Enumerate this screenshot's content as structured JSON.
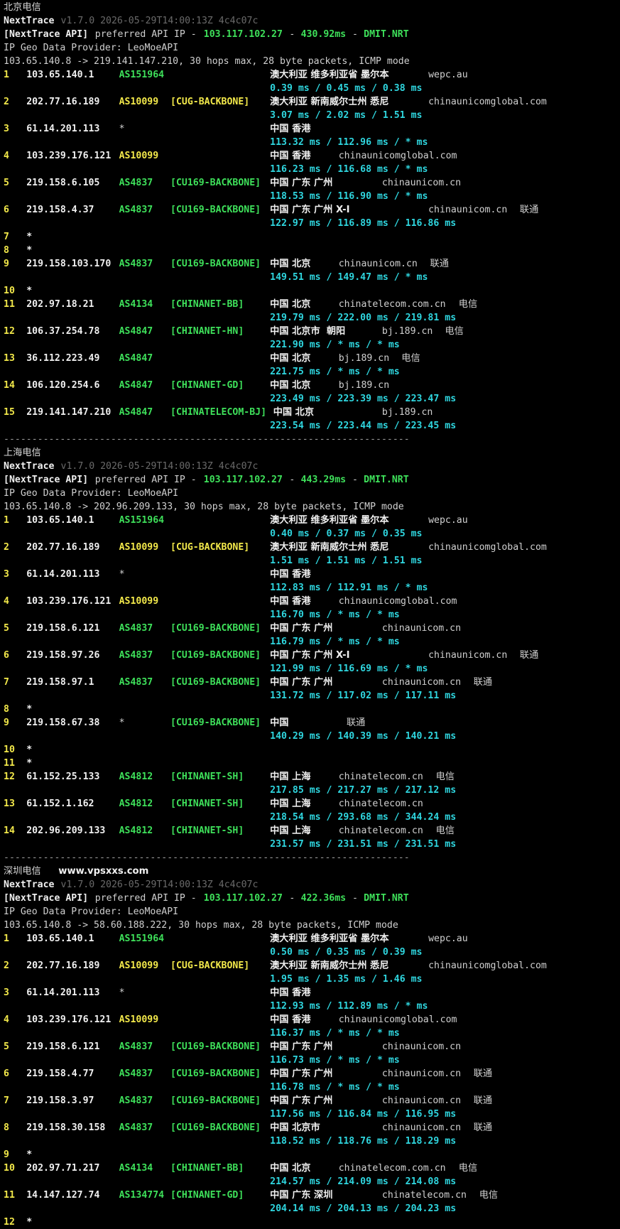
{
  "colors": {
    "background": "#000000",
    "green": "#3ee05a",
    "yellow": "#f2e84a",
    "cyan": "#2fd6df",
    "white": "#f0f0f0",
    "dim": "#6a6a6a"
  },
  "separator": "------------------------------------------------------------------------",
  "sections": [
    {
      "title": "北京电信",
      "watermark": "",
      "app": "NextTrace",
      "version": "v1.7.0 2026-05-29T14:00:13Z 4c4c07c",
      "api_tag": "[NextTrace API]",
      "api_text": "preferred API IP - ",
      "api_ip": "103.117.102.27",
      "api_latency": "430.92ms",
      "api_node": "DMIT.NRT",
      "geo_provider": "IP Geo Data Provider: LeoMoeAPI",
      "route_info": "103.65.140.8 -> 219.141.147.210, 30 hops max, 28 byte packets, ICMP mode",
      "hops": [
        {
          "n": "1",
          "ip": "103.65.140.1",
          "as": "AS151964",
          "asc": "g",
          "tag": "",
          "tagc": "",
          "geo": "澳大利亚 维多利亚省 墨尔本",
          "dom": "wepc.au",
          "isp": "",
          "rtt": "0.39 ms / 0.45 ms / 0.38 ms"
        },
        {
          "n": "2",
          "ip": "202.77.16.189",
          "as": "AS10099",
          "asc": "y",
          "tag": "[CUG-BACKBONE]",
          "tagc": "y",
          "geo": "澳大利亚 新南威尔士州 悉尼",
          "dom": "chinaunicomglobal.com",
          "isp": "",
          "rtt": "3.07 ms / 2.02 ms / 1.51 ms"
        },
        {
          "n": "3",
          "ip": "61.14.201.113",
          "as": "*",
          "asc": "p",
          "tag": "",
          "tagc": "",
          "geo": "中国 香港",
          "dom": "",
          "isp": "",
          "rtt": "113.32 ms / 112.96 ms / * ms"
        },
        {
          "n": "4",
          "ip": "103.239.176.121",
          "as": "AS10099",
          "asc": "y",
          "tag": "",
          "tagc": "",
          "geo": "中国 香港",
          "dom": "chinaunicomglobal.com",
          "isp": "",
          "rtt": "116.23 ms / 116.68 ms / * ms"
        },
        {
          "n": "5",
          "ip": "219.158.6.105",
          "as": "AS4837",
          "asc": "g",
          "tag": "[CU169-BACKBONE]",
          "tagc": "g",
          "geo": "中国 广东 广州",
          "dom": "chinaunicom.cn",
          "isp": "",
          "rtt": "118.53 ms / 116.90 ms / * ms"
        },
        {
          "n": "6",
          "ip": "219.158.4.37",
          "as": "AS4837",
          "asc": "g",
          "tag": "[CU169-BACKBONE]",
          "tagc": "g",
          "geo": "中国 广东 广州 X-I",
          "dom": "chinaunicom.cn",
          "isp": "联通",
          "rtt": "122.97 ms / 116.89 ms / 116.86 ms"
        },
        {
          "n": "7",
          "star": true
        },
        {
          "n": "8",
          "star": true
        },
        {
          "n": "9",
          "ip": "219.158.103.170",
          "as": "AS4837",
          "asc": "g",
          "tag": "[CU169-BACKBONE]",
          "tagc": "g",
          "geo": "中国 北京",
          "dom": "chinaunicom.cn",
          "isp": "联通",
          "rtt": "149.51 ms / 149.47 ms / * ms"
        },
        {
          "n": "10",
          "star": true
        },
        {
          "n": "11",
          "ip": "202.97.18.21",
          "as": "AS4134",
          "asc": "g",
          "tag": "[CHINANET-BB]",
          "tagc": "g",
          "geo": "中国 北京",
          "dom": "chinatelecom.com.cn",
          "isp": "电信",
          "rtt": "219.79 ms / 222.00 ms / 219.81 ms"
        },
        {
          "n": "12",
          "ip": "106.37.254.78",
          "as": "AS4847",
          "asc": "g",
          "tag": "[CHINANET-HN]",
          "tagc": "g",
          "geo": "中国 北京市  朝阳",
          "dom": "bj.189.cn",
          "isp": "电信",
          "rtt": "221.90 ms / * ms / * ms"
        },
        {
          "n": "13",
          "ip": "36.112.223.49",
          "as": "AS4847",
          "asc": "g",
          "tag": "",
          "tagc": "",
          "geo": "中国 北京",
          "dom": "bj.189.cn",
          "isp": "电信",
          "rtt": "221.75 ms / * ms / * ms"
        },
        {
          "n": "14",
          "ip": "106.120.254.6",
          "as": "AS4847",
          "asc": "g",
          "tag": "[CHINANET-GD]",
          "tagc": "g",
          "geo": "中国 北京",
          "dom": "bj.189.cn",
          "isp": "",
          "rtt": "223.49 ms / 223.39 ms / 223.47 ms"
        },
        {
          "n": "15",
          "ip": "219.141.147.210",
          "as": "AS4847",
          "asc": "g",
          "tag": "[CHINATELECOM-BJ]",
          "tagc": "g",
          "geo": " 中国 北京",
          "dom": "bj.189.cn",
          "isp": "",
          "rtt": "223.54 ms / 223.44 ms / 223.45 ms"
        }
      ]
    },
    {
      "title": "上海电信",
      "watermark": "",
      "app": "NextTrace",
      "version": "v1.7.0 2026-05-29T14:00:13Z 4c4c07c",
      "api_tag": "[NextTrace API]",
      "api_text": "preferred API IP - ",
      "api_ip": "103.117.102.27",
      "api_latency": "443.29ms",
      "api_node": "DMIT.NRT",
      "geo_provider": "IP Geo Data Provider: LeoMoeAPI",
      "route_info": "103.65.140.8 -> 202.96.209.133, 30 hops max, 28 byte packets, ICMP mode",
      "hops": [
        {
          "n": "1",
          "ip": "103.65.140.1",
          "as": "AS151964",
          "asc": "g",
          "tag": "",
          "tagc": "",
          "geo": "澳大利亚 维多利亚省 墨尔本",
          "dom": "wepc.au",
          "isp": "",
          "rtt": "0.40 ms / 0.37 ms / 0.35 ms"
        },
        {
          "n": "2",
          "ip": "202.77.16.189",
          "as": "AS10099",
          "asc": "y",
          "tag": "[CUG-BACKBONE]",
          "tagc": "y",
          "geo": "澳大利亚 新南威尔士州 悉尼",
          "dom": "chinaunicomglobal.com",
          "isp": "",
          "rtt": "1.51 ms / 1.51 ms / 1.51 ms"
        },
        {
          "n": "3",
          "ip": "61.14.201.113",
          "as": "*",
          "asc": "p",
          "tag": "",
          "tagc": "",
          "geo": "中国 香港",
          "dom": "",
          "isp": "",
          "rtt": "112.83 ms / 112.91 ms / * ms"
        },
        {
          "n": "4",
          "ip": "103.239.176.121",
          "as": "AS10099",
          "asc": "y",
          "tag": "",
          "tagc": "",
          "geo": "中国 香港",
          "dom": "chinaunicomglobal.com",
          "isp": "",
          "rtt": "116.70 ms / * ms / * ms"
        },
        {
          "n": "5",
          "ip": "219.158.6.121",
          "as": "AS4837",
          "asc": "g",
          "tag": "[CU169-BACKBONE]",
          "tagc": "g",
          "geo": "中国 广东 广州",
          "dom": "chinaunicom.cn",
          "isp": "",
          "rtt": "116.79 ms / * ms / * ms"
        },
        {
          "n": "6",
          "ip": "219.158.97.26",
          "as": "AS4837",
          "asc": "g",
          "tag": "[CU169-BACKBONE]",
          "tagc": "g",
          "geo": "中国 广东 广州 X-I",
          "dom": "chinaunicom.cn",
          "isp": "联通",
          "rtt": "121.99 ms / 116.69 ms / * ms"
        },
        {
          "n": "7",
          "ip": "219.158.97.1",
          "as": "AS4837",
          "asc": "g",
          "tag": "[CU169-BACKBONE]",
          "tagc": "g",
          "geo": "中国 广东 广州",
          "dom": "chinaunicom.cn",
          "isp": "联通",
          "rtt": "131.72 ms / 117.02 ms / 117.11 ms"
        },
        {
          "n": "8",
          "star": true
        },
        {
          "n": "9",
          "ip": "219.158.67.38",
          "as": "*",
          "asc": "p",
          "tag": "[CU169-BACKBONE]",
          "tagc": "g",
          "geo": "中国",
          "dom": "",
          "isp": "联通",
          "rtt": "140.29 ms / 140.39 ms / 140.21 ms"
        },
        {
          "n": "10",
          "star": true
        },
        {
          "n": "11",
          "star": true
        },
        {
          "n": "12",
          "ip": "61.152.25.133",
          "as": "AS4812",
          "asc": "g",
          "tag": "[CHINANET-SH]",
          "tagc": "g",
          "geo": "中国 上海",
          "dom": "chinatelecom.cn",
          "isp": "电信",
          "rtt": "217.85 ms / 217.27 ms / 217.12 ms"
        },
        {
          "n": "13",
          "ip": "61.152.1.162",
          "as": "AS4812",
          "asc": "g",
          "tag": "[CHINANET-SH]",
          "tagc": "g",
          "geo": "中国 上海",
          "dom": "chinatelecom.cn",
          "isp": "",
          "rtt": "218.54 ms / 293.68 ms / 344.24 ms"
        },
        {
          "n": "14",
          "ip": "202.96.209.133",
          "as": "AS4812",
          "asc": "g",
          "tag": "[CHINANET-SH]",
          "tagc": "g",
          "geo": "中国 上海",
          "dom": "chinatelecom.cn",
          "isp": "电信",
          "rtt": "231.57 ms / 231.51 ms / 231.51 ms"
        }
      ]
    },
    {
      "title": "深圳电信",
      "watermark": "www.vpsxxs.com",
      "app": "NextTrace",
      "version": "v1.7.0 2026-05-29T14:00:13Z 4c4c07c",
      "api_tag": "[NextTrace API]",
      "api_text": "preferred API IP - ",
      "api_ip": "103.117.102.27",
      "api_latency": "422.36ms",
      "api_node": "DMIT.NRT",
      "geo_provider": "IP Geo Data Provider: LeoMoeAPI",
      "route_info": "103.65.140.8 -> 58.60.188.222, 30 hops max, 28 byte packets, ICMP mode",
      "hops": [
        {
          "n": "1",
          "ip": "103.65.140.1",
          "as": "AS151964",
          "asc": "g",
          "tag": "",
          "tagc": "",
          "geo": "澳大利亚 维多利亚省 墨尔本",
          "dom": "wepc.au",
          "isp": "",
          "rtt": "0.50 ms / 0.35 ms / 0.39 ms"
        },
        {
          "n": "2",
          "ip": "202.77.16.189",
          "as": "AS10099",
          "asc": "y",
          "tag": "[CUG-BACKBONE]",
          "tagc": "y",
          "geo": "澳大利亚 新南威尔士州 悉尼",
          "dom": "chinaunicomglobal.com",
          "isp": "",
          "rtt": "1.95 ms / 1.35 ms / 1.46 ms"
        },
        {
          "n": "3",
          "ip": "61.14.201.113",
          "as": "*",
          "asc": "p",
          "tag": "",
          "tagc": "",
          "geo": "中国 香港",
          "dom": "",
          "isp": "",
          "rtt": "112.93 ms / 112.89 ms / * ms"
        },
        {
          "n": "4",
          "ip": "103.239.176.121",
          "as": "AS10099",
          "asc": "y",
          "tag": "",
          "tagc": "",
          "geo": "中国 香港",
          "dom": "chinaunicomglobal.com",
          "isp": "",
          "rtt": "116.37 ms / * ms / * ms"
        },
        {
          "n": "5",
          "ip": "219.158.6.121",
          "as": "AS4837",
          "asc": "g",
          "tag": "[CU169-BACKBONE]",
          "tagc": "g",
          "geo": "中国 广东 广州",
          "dom": "chinaunicom.cn",
          "isp": "",
          "rtt": "116.73 ms / * ms / * ms"
        },
        {
          "n": "6",
          "ip": "219.158.4.77",
          "as": "AS4837",
          "asc": "g",
          "tag": "[CU169-BACKBONE]",
          "tagc": "g",
          "geo": "中国 广东 广州",
          "dom": "chinaunicom.cn",
          "isp": "联通",
          "rtt": "116.78 ms / * ms / * ms"
        },
        {
          "n": "7",
          "ip": "219.158.3.97",
          "as": "AS4837",
          "asc": "g",
          "tag": "[CU169-BACKBONE]",
          "tagc": "g",
          "geo": "中国 广东 广州",
          "dom": "chinaunicom.cn",
          "isp": "联通",
          "rtt": "117.56 ms / 116.84 ms / 116.95 ms"
        },
        {
          "n": "8",
          "ip": "219.158.30.158",
          "as": "AS4837",
          "asc": "g",
          "tag": "[CU169-BACKBONE]",
          "tagc": "g",
          "geo": "中国 北京市",
          "dom": "chinaunicom.cn",
          "isp": "联通",
          "rtt": "118.52 ms / 118.76 ms / 118.29 ms"
        },
        {
          "n": "9",
          "star": true
        },
        {
          "n": "10",
          "ip": "202.97.71.217",
          "as": "AS4134",
          "asc": "g",
          "tag": "[CHINANET-BB]",
          "tagc": "g",
          "geo": "中国 北京",
          "dom": "chinatelecom.com.cn",
          "isp": "电信",
          "rtt": "214.57 ms / 214.09 ms / 214.08 ms"
        },
        {
          "n": "11",
          "ip": "14.147.127.74",
          "as": "AS134774",
          "asc": "g",
          "tag": "[CHINANET-GD]",
          "tagc": "g",
          "geo": "中国 广东 深圳",
          "dom": "chinatelecom.cn",
          "isp": "电信",
          "rtt": "204.14 ms / 204.13 ms / 204.23 ms"
        },
        {
          "n": "12",
          "star": true
        }
      ]
    }
  ]
}
